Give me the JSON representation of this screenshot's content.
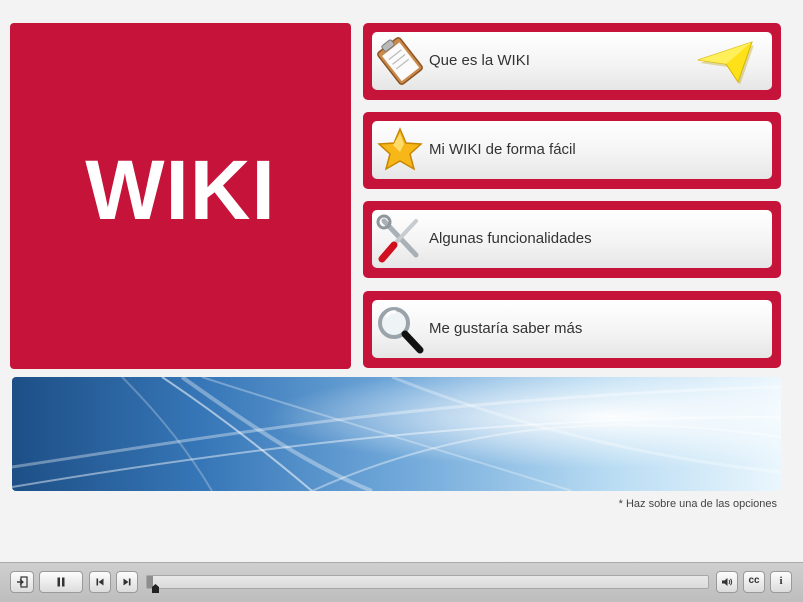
{
  "title_panel": {
    "text": "WIKI",
    "color": "#c5133a"
  },
  "menu": [
    {
      "label": "Que es la WIKI",
      "icon": "clipboard-icon",
      "show_cursor": true
    },
    {
      "label": "Mi WIKI de forma fácil",
      "icon": "star-icon"
    },
    {
      "label": "Algunas funcionalidades",
      "icon": "tools-icon"
    },
    {
      "label": "Me gustaría saber más",
      "icon": "magnifier-icon"
    }
  ],
  "hint": "* Haz sobre una de las opciones",
  "player": {
    "buttons": [
      "exit-icon",
      "pause-icon",
      "previous-icon",
      "next-icon",
      "volume-icon",
      "captions-icon",
      "info-icon"
    ],
    "captions_label": "cc",
    "info_label": "i",
    "progress": 0.01
  },
  "colors": {
    "accent": "#c5133a",
    "background": "#f3f3f3"
  }
}
